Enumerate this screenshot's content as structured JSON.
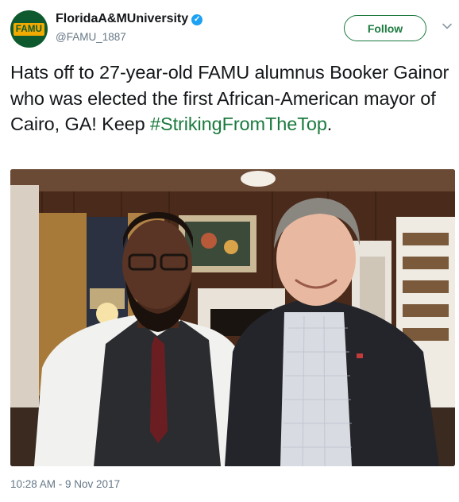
{
  "header": {
    "avatar_text": "FAMU",
    "display_name": "FloridaA&MUniversity",
    "verified_icon": "verified-badge-icon",
    "handle": "@FAMU_1887",
    "follow_label": "Follow",
    "caret_icon": "chevron-down-icon"
  },
  "tweet": {
    "text": "Hats off to 27-year-old FAMU alumnus Booker Gainor who was elected the first African-American mayor of Cairo, GA! Keep ",
    "hashtag": "#StrikingFromTheTop",
    "trailing": "."
  },
  "colors": {
    "brand_green": "#1b7a3e",
    "brand_gold": "#f2a900",
    "muted_text": "#657786",
    "verified_blue": "#1da1f2"
  },
  "footer": {
    "timestamp": "10:28 AM - 9 Nov 2017"
  }
}
